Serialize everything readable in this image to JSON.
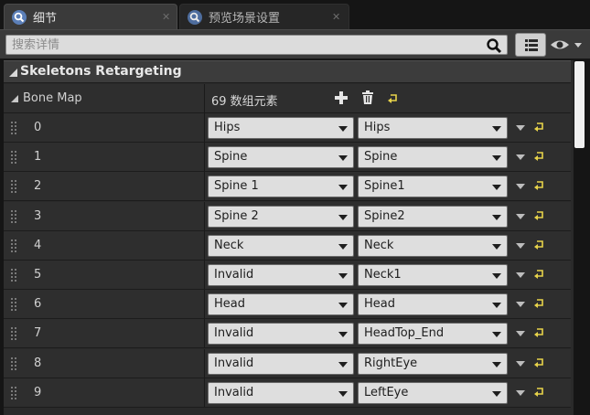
{
  "tabs": [
    {
      "label": "细节",
      "active": true
    },
    {
      "label": "预览场景设置",
      "active": false
    }
  ],
  "search": {
    "placeholder": "搜索详情"
  },
  "category": {
    "title": "Skeletons Retargeting"
  },
  "bone_map": {
    "label": "Bone Map",
    "count_label": "69 数组元素"
  },
  "rows": [
    {
      "index": "0",
      "source": "Hips",
      "target": "Hips"
    },
    {
      "index": "1",
      "source": "Spine",
      "target": "Spine"
    },
    {
      "index": "2",
      "source": "Spine 1",
      "target": "Spine1"
    },
    {
      "index": "3",
      "source": "Spine 2",
      "target": "Spine2"
    },
    {
      "index": "4",
      "source": "Neck",
      "target": "Neck"
    },
    {
      "index": "5",
      "source": "Invalid",
      "target": "Neck1"
    },
    {
      "index": "6",
      "source": "Head",
      "target": "Head"
    },
    {
      "index": "7",
      "source": "Invalid",
      "target": "HeadTop_End"
    },
    {
      "index": "8",
      "source": "Invalid",
      "target": "RightEye"
    },
    {
      "index": "9",
      "source": "Invalid",
      "target": "LeftEye"
    }
  ],
  "icons": {
    "tab_details": "details-icon",
    "tab_preview": "details-icon",
    "search": "search-icon",
    "view_options": "grid-icon",
    "visibility": "eye-icon",
    "add": "plus-icon",
    "delete": "trash-icon",
    "reset": "reset-arrow-icon",
    "grip": "drag-handle-icon"
  },
  "colors": {
    "accent_yellow": "#e8d44a",
    "background": "#151515",
    "panel": "#2e2e2e",
    "combo": "#dedede"
  }
}
